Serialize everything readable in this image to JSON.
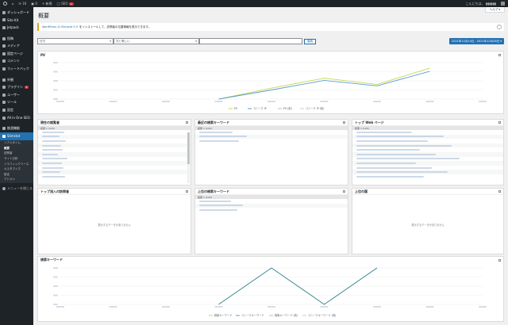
{
  "adminbar": {
    "count": "16",
    "comments": "0",
    "new_label": "新規",
    "seo_label": "SEO",
    "seo_badge": "1",
    "greeting": "こんにちは、"
  },
  "sidebar": {
    "items": [
      {
        "label": "ダッシュボード"
      },
      {
        "label": "Site Kit"
      },
      {
        "label": "Jetpack"
      },
      {
        "label": "投稿"
      },
      {
        "label": "メディア"
      },
      {
        "label": "固定ページ"
      },
      {
        "label": "コメント"
      },
      {
        "label": "フィードバック"
      },
      {
        "label": "外観"
      },
      {
        "label": "プラグイン",
        "count": "4"
      },
      {
        "label": "ユーザー"
      },
      {
        "label": "ツール"
      },
      {
        "label": "設定"
      },
      {
        "label": "All in One SEO"
      },
      {
        "label": "推奨機能"
      },
      {
        "label": "Slimstat"
      }
    ],
    "submenu": [
      "リアルタイム",
      "概要",
      "訪問者",
      "サイト分析",
      "トラフィックソース",
      "カスタマイズ",
      "設定",
      "アドオン"
    ],
    "collapse_label": "メニューを閉じる"
  },
  "page": {
    "help_label": "ヘルプ ▾",
    "title": "概要",
    "notice_link": "WordPress の Slimstat 5.0",
    "notice_text": "をインストールして、訪問者の位置情報を表示できます。",
    "filter_select1": "日付",
    "filter_select2": "次と等しい",
    "filter_button": "適用",
    "date_range": "2021年12月14日 - 2021年12月28日 ▾"
  },
  "pv_panel": {
    "title": "PV",
    "legend": [
      "PV",
      "ユニーク IP",
      "PV (前)",
      "ユニーク IP (前)"
    ]
  },
  "panels": {
    "current_visitors": "現在の閲覧者",
    "recent_keywords": "最近の検索キーワード",
    "top_pages": "トップ Web ページ",
    "top_referrers": "トップ流入の訪問者",
    "top_keywords": "上位の検索キーワード",
    "top_countries": "上位の国",
    "search_keywords": "検索キーワード",
    "table_header_recent": "結果 1 (120)",
    "table_header_pages": "結果 1 (120)",
    "table_header_top_kw": "結果 1 (120)",
    "no_data": "表示するデータがありません"
  },
  "kw_panel": {
    "legend": [
      "検索キーワード",
      "ユニークキーワード",
      "検索キーワード (前)",
      "ユニークキーワード (前)"
    ]
  },
  "colors": {
    "accent": "#2271b1",
    "pv_green": "#c5d94a",
    "pv_blue": "#5b9bd5",
    "kw_teal": "#2e7d8c",
    "sidebar": "#1d2327"
  },
  "chart_data": [
    {
      "type": "line",
      "title": "PV",
      "x": [
        0,
        1,
        2,
        3,
        4,
        5,
        6,
        7,
        8
      ],
      "series": [
        {
          "name": "PV",
          "values": [
            null,
            null,
            null,
            0,
            120,
            230,
            160,
            340,
            null
          ]
        },
        {
          "name": "ユニーク IP",
          "values": [
            null,
            null,
            null,
            0,
            100,
            205,
            145,
            305,
            null
          ]
        }
      ]
    },
    {
      "type": "line",
      "title": "検索キーワード",
      "x": [
        0,
        1,
        2,
        3,
        4,
        5,
        6,
        7,
        8
      ],
      "series": [
        {
          "name": "検索キーワード",
          "values": [
            null,
            null,
            null,
            0,
            1,
            0,
            1,
            null,
            null
          ]
        }
      ]
    }
  ]
}
